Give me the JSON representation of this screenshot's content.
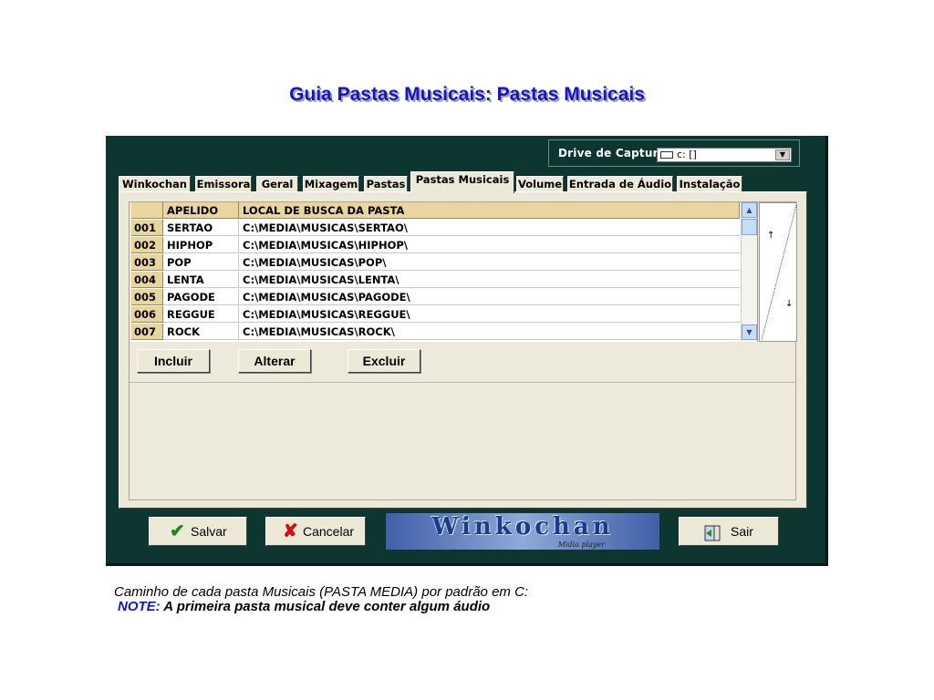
{
  "page": {
    "title": "Guia Pastas Musicais: Pastas Musicais",
    "caption_line1": "Caminho de cada pasta Musicais (PASTA MEDIA) por padrão em C:",
    "caption_note_prefix": "NOTE:",
    "caption_note_text": "A primeira pasta musical deve conter algum áudio"
  },
  "window": {
    "drive_label": "Drive de Captura:",
    "drive_value": "c: []",
    "tabs": [
      {
        "label": "Winkochan",
        "active": false
      },
      {
        "label": "Emissora",
        "active": false
      },
      {
        "label": "Geral",
        "active": false
      },
      {
        "label": "Mixagem",
        "active": false
      },
      {
        "label": "Pastas",
        "active": false
      },
      {
        "label": "Pastas Musicais",
        "active": true
      },
      {
        "label": "Volume",
        "active": false
      },
      {
        "label": "Entrada de Áudio",
        "active": false
      },
      {
        "label": "Instalação",
        "active": false
      }
    ],
    "grid": {
      "headers": [
        "",
        "APELIDO",
        "LOCAL DE BUSCA DA PASTA"
      ],
      "rows": [
        [
          "001",
          "SERTAO",
          "C:\\MEDIA\\MUSICAS\\SERTAO\\"
        ],
        [
          "002",
          "HIPHOP",
          "C:\\MEDIA\\MUSICAS\\HIPHOP\\"
        ],
        [
          "003",
          "POP",
          "C:\\MEDIA\\MUSICAS\\POP\\"
        ],
        [
          "004",
          "LENTA",
          "C:\\MEDIA\\MUSICAS\\LENTA\\"
        ],
        [
          "005",
          "PAGODE",
          "C:\\MEDIA\\MUSICAS\\PAGODE\\"
        ],
        [
          "006",
          "REGGUE",
          "C:\\MEDIA\\MUSICAS\\REGGUE\\"
        ],
        [
          "007",
          "ROCK",
          "C:\\MEDIA\\MUSICAS\\ROCK\\"
        ]
      ]
    },
    "actions": {
      "incluir": "Incluir",
      "alterar": "Alterar",
      "excluir": "Excluir"
    },
    "footer": {
      "salvar": "Salvar",
      "cancelar": "Cancelar",
      "logo_text": "Winkochan",
      "logo_sub": "Midia player",
      "sair": "Sair"
    }
  },
  "colors": {
    "title": "#1414c8",
    "window_bg": "#0e3630",
    "panel_bg": "#ece9d8",
    "grid_header": "#e8d5a0",
    "salvar_icon": "#1e8a1e",
    "cancelar_icon": "#cc1111"
  },
  "icons": {
    "salvar": "checkmark-icon",
    "cancelar": "x-icon",
    "sair": "exit-door-icon",
    "drive": "keyboard-drive-icon"
  }
}
